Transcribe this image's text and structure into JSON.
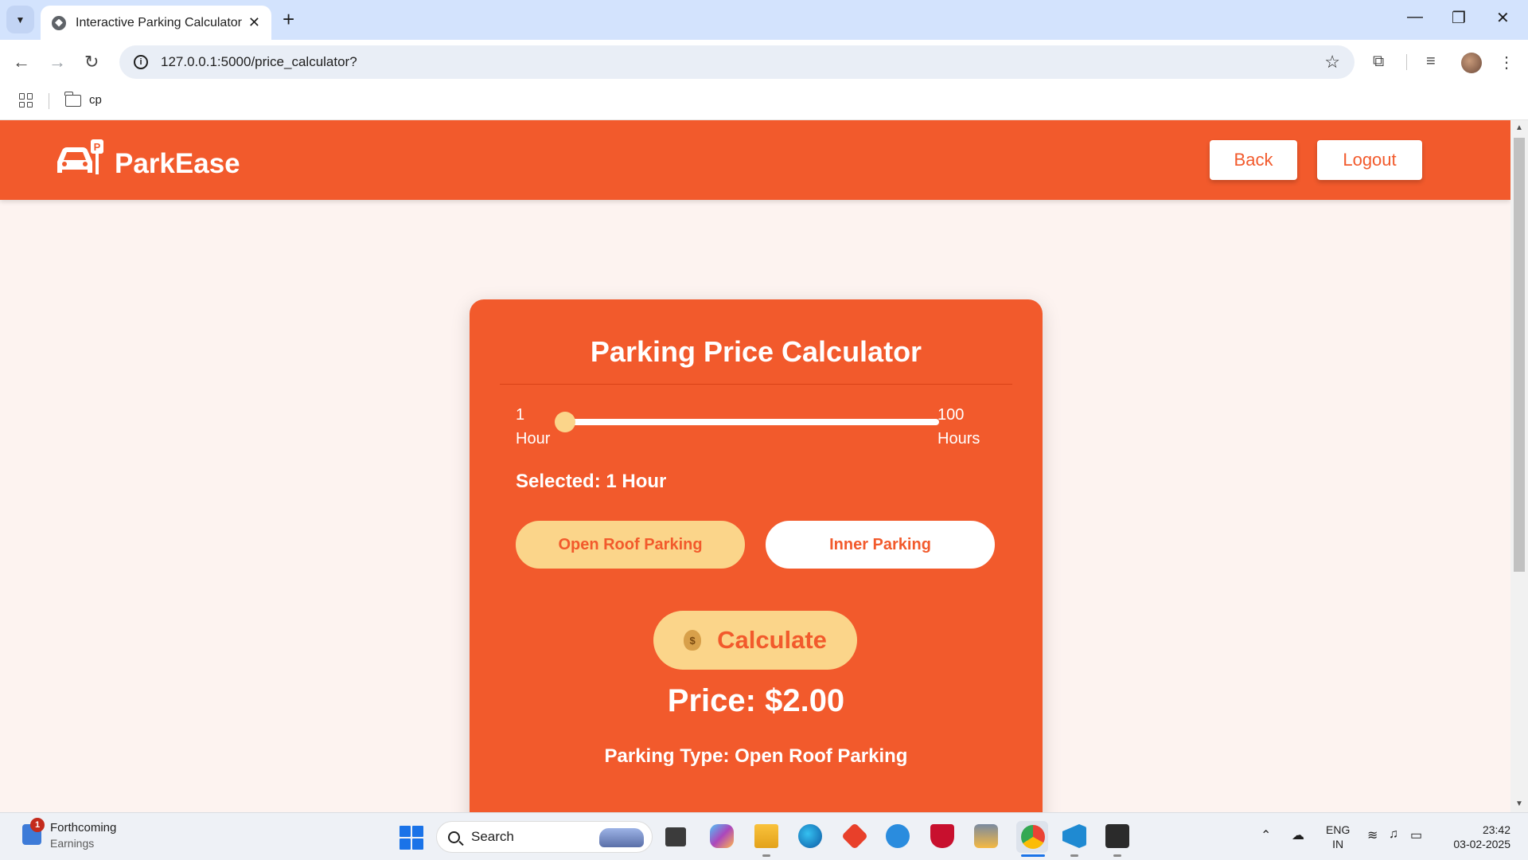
{
  "browser": {
    "tab_title": "Interactive Parking Calculator",
    "tab_close": "✕",
    "new_tab": "+",
    "url": "127.0.0.1:5000/price_calculator?",
    "bookmark": "cp",
    "window_controls": [
      "—",
      "❐",
      "✕"
    ]
  },
  "app": {
    "brand": "ParkEase",
    "back_label": "Back",
    "logout_label": "Logout"
  },
  "calculator": {
    "title": "Parking Price Calculator",
    "range_min": "1",
    "range_min_unit": "Hour",
    "range_max": "100",
    "range_max_unit": "Hours",
    "slider_value": 1,
    "slider_min": 1,
    "slider_max": 100,
    "selected_text": "Selected: 1 Hour",
    "option_open": "Open Roof Parking",
    "option_inner": "Inner Parking",
    "selected_option": "Open Roof Parking",
    "calculate_label": "Calculate",
    "price_text": "Price: $2.00",
    "parking_type_text": "Parking Type: Open Roof Parking"
  },
  "colors": {
    "brand": "#f25a2c",
    "accent": "#fbd58a",
    "page_bg": "#fdf3f0"
  },
  "taskbar": {
    "widget_badge": "1",
    "widget_title": "Forthcoming",
    "widget_sub": "Earnings",
    "search_label": "Search",
    "lang_line1": "ENG",
    "lang_line2": "IN",
    "time": "23:42",
    "date": "03-02-2025"
  }
}
